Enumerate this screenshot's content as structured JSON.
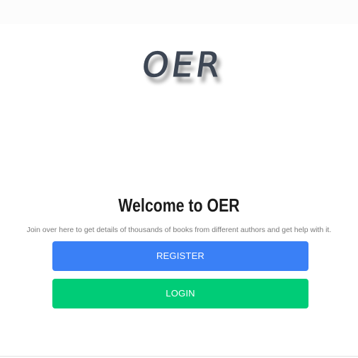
{
  "logo": {
    "text": "OER"
  },
  "welcome": {
    "title": "Welcome to OER",
    "subtitle": "Join over here to get details of thousands of books from different authors and get help with it."
  },
  "actions": {
    "register_label": "REGISTER",
    "login_label": "LOGIN"
  },
  "colors": {
    "register": "#3a80f6",
    "login": "#00cc77",
    "logo": "#3d4654"
  }
}
